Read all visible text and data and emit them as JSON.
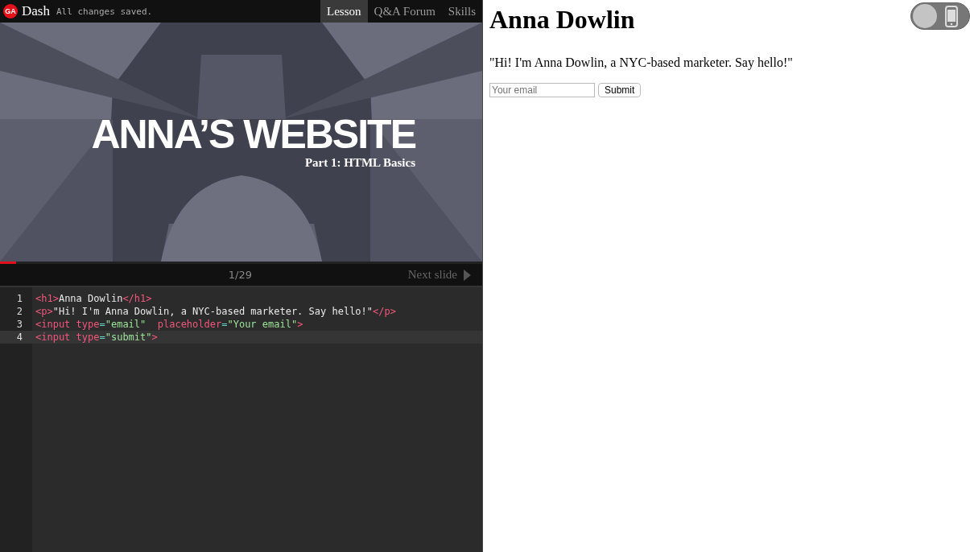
{
  "topbar": {
    "logo": "GA",
    "app_name": "Dash",
    "status": "All changes saved.",
    "tabs": [
      {
        "label": "Lesson",
        "selected": true
      },
      {
        "label": "Q&A Forum",
        "selected": false
      },
      {
        "label": "Skills",
        "selected": false
      }
    ]
  },
  "slide": {
    "kind": "picture",
    "title": "ANNA’S WEBSITE",
    "subtitle": "Part 1: HTML Basics"
  },
  "slide_nav": {
    "level": 0.034,
    "counter": "1/29",
    "next": "Next slide"
  },
  "editor": {
    "lines": [
      {
        "number": "1",
        "current": false,
        "tokens": [
          {
            "kind": "tag",
            "text": "<h1>"
          },
          {
            "kind": "text",
            "text": "Anna Dowlin"
          },
          {
            "kind": "tag",
            "text": "</h1>"
          }
        ]
      },
      {
        "number": "2",
        "current": false,
        "tokens": [
          {
            "kind": "tag",
            "text": "<p>"
          },
          {
            "kind": "text",
            "text": "\"Hi! I'm Anna Dowlin, a NYC-based marketer. Say hello!\""
          },
          {
            "kind": "tag",
            "text": "</p>"
          }
        ]
      },
      {
        "number": "3",
        "current": false,
        "tokens": [
          {
            "kind": "tag",
            "text": "<input "
          },
          {
            "kind": "attr",
            "text": "type"
          },
          {
            "kind": "op",
            "text": "="
          },
          {
            "kind": "string",
            "text": "\"email\""
          },
          {
            "kind": "attr",
            "text": "  placeholder"
          },
          {
            "kind": "op",
            "text": "="
          },
          {
            "kind": "string",
            "text": "\"Your email\""
          },
          {
            "kind": "tag",
            "text": ">"
          }
        ]
      },
      {
        "number": "4",
        "current": true,
        "tokens": [
          {
            "kind": "tag",
            "text": "<input "
          },
          {
            "kind": "attr",
            "text": "type"
          },
          {
            "kind": "op",
            "text": "="
          },
          {
            "kind": "string",
            "text": "\"submit\""
          },
          {
            "kind": "tag",
            "text": ">"
          }
        ]
      }
    ]
  },
  "preview": {
    "heading": "Anna Dowlin",
    "paragraph": "\"Hi! I'm Anna Dowlin, a NYC-based marketer. Say hello!\"",
    "email": {
      "placeholder": "Your email"
    },
    "submit": "Submit",
    "mobile_toggle": {
      "on": false
    }
  }
}
